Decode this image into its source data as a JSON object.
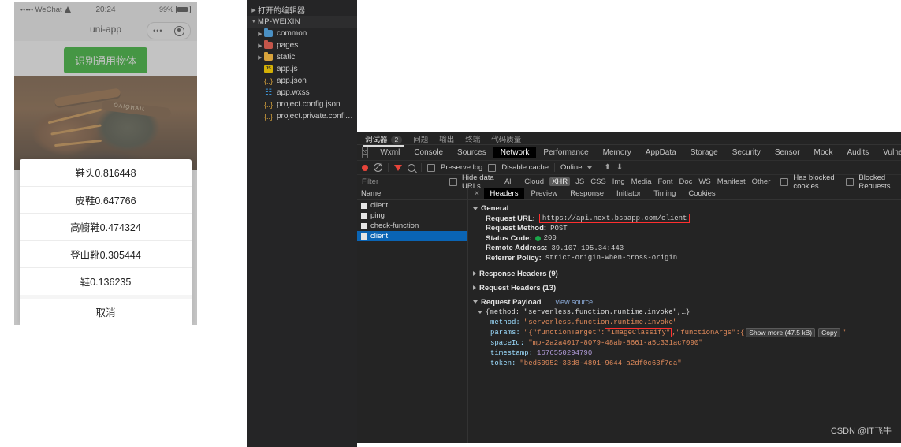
{
  "phone": {
    "statusbar": {
      "carrier": "WeChat",
      "dots": "•••••",
      "time": "20:24",
      "battery": "99%"
    },
    "navbar": {
      "title": "uni-app",
      "capsule_dots": "•••"
    },
    "recognize_button": "识别通用物体",
    "photo_brand": "JIANQIAO",
    "action_sheet": {
      "items": [
        "鞋头0.816448",
        "皮鞋0.647766",
        "高幮鞋0.474324",
        "登山靴0.305444",
        "鞋0.136235"
      ],
      "cancel": "取消"
    },
    "predictions": [
      {
        "label": "鞋头",
        "score": 0.816448
      },
      {
        "label": "皮鞋",
        "score": 0.647766
      },
      {
        "label": "高幮鞋",
        "score": 0.474324
      },
      {
        "label": "登山靴",
        "score": 0.305444
      },
      {
        "label": "鞋",
        "score": 0.136235
      }
    ]
  },
  "explorer": {
    "open_editors": "打开的编辑器",
    "project_root": "MP-WEIXIN",
    "items": [
      {
        "label": "common",
        "kind": "folder",
        "color": "blue"
      },
      {
        "label": "pages",
        "kind": "folder",
        "color": "red"
      },
      {
        "label": "static",
        "kind": "folder",
        "color": "yellow"
      },
      {
        "label": "app.js",
        "kind": "js"
      },
      {
        "label": "app.json",
        "kind": "json"
      },
      {
        "label": "app.wxss",
        "kind": "wxss"
      },
      {
        "label": "project.config.json",
        "kind": "json"
      },
      {
        "label": "project.private.config.js...",
        "kind": "json"
      }
    ]
  },
  "devtools": {
    "panel_tabs": [
      {
        "label": "调试器",
        "badge": "2",
        "active": true
      },
      {
        "label": "问题",
        "active": false
      },
      {
        "label": "输出",
        "active": false
      },
      {
        "label": "终端",
        "active": false
      },
      {
        "label": "代码质量",
        "active": false
      }
    ],
    "tabs": [
      "Wxml",
      "Console",
      "Sources",
      "Network",
      "Performance",
      "Memory",
      "AppData",
      "Storage",
      "Security",
      "Sensor",
      "Mock",
      "Audits",
      "Vulnerability"
    ],
    "selected_tab": "Network",
    "toolbar": {
      "preserve_log": "Preserve log",
      "disable_cache": "Disable cache",
      "throttle": "Online"
    },
    "filter": {
      "placeholder": "Filter",
      "hide_data_urls": "Hide data URLs",
      "types": [
        "All",
        "Cloud",
        "XHR",
        "JS",
        "CSS",
        "Img",
        "Media",
        "Font",
        "Doc",
        "WS",
        "Manifest",
        "Other"
      ],
      "selected_type": "XHR",
      "has_blocked_cookies": "Has blocked cookies",
      "blocked_requests": "Blocked Requests"
    },
    "request_list": {
      "header": "Name",
      "rows": [
        {
          "name": "client",
          "selected": false
        },
        {
          "name": "ping",
          "selected": false
        },
        {
          "name": "check-function",
          "selected": false
        },
        {
          "name": "client",
          "selected": true
        }
      ]
    },
    "detail_tabs": [
      "Headers",
      "Preview",
      "Response",
      "Initiator",
      "Timing",
      "Cookies"
    ],
    "selected_detail_tab": "Headers",
    "general": {
      "title": "General",
      "request_url_key": "Request URL:",
      "request_url": "https://api.next.bspapp.com/client",
      "request_method_key": "Request Method:",
      "request_method": "POST",
      "status_code_key": "Status Code:",
      "status_code": "200",
      "remote_address_key": "Remote Address:",
      "remote_address": "39.107.195.34:443",
      "referrer_policy_key": "Referrer Policy:",
      "referrer_policy": "strict-origin-when-cross-origin"
    },
    "response_headers": "Response Headers (9)",
    "request_headers": "Request Headers (13)",
    "payload": {
      "title": "Request Payload",
      "view_source": "view source",
      "root_line": "{method: \"serverless.function.runtime.invoke\",…}",
      "method_key": "method:",
      "method_value": "\"serverless.function.runtime.invoke\"",
      "params_key": "params:",
      "params_prefix": "\"{\"functionTarget\":",
      "params_highlight": "\"ImageClassify\"",
      "params_suffix": ",\"functionArgs\":{",
      "show_more": "Show more (47.5 kB)",
      "copy": "Copy",
      "params_tail": "\"",
      "spaceid_key": "spaceId:",
      "spaceid_value": "\"mp-2a2a4017-8079-48ab-8661-a5c331ac7090\"",
      "timestamp_key": "timestamp:",
      "timestamp_value": "1676550294790",
      "token_key": "token:",
      "token_value": "\"bed50952-33d8-4891-9644-a2df0c63f7da\""
    }
  },
  "watermark": "CSDN @IT飞牛",
  "colors": {
    "accent_green": "#1aad19",
    "selection_blue": "#0a64b4",
    "highlight_red": "#ff2f2f",
    "devtools_bg": "#242424",
    "explorer_bg": "#252526"
  }
}
